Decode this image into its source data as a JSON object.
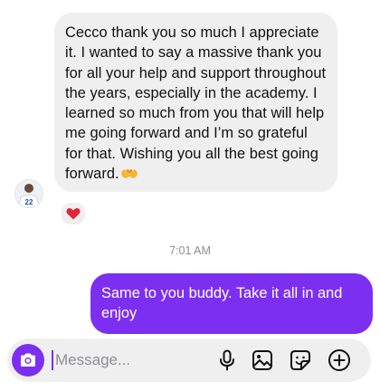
{
  "conversation": {
    "incoming_message": {
      "text": "Cecco thank you so much I appreciate it. I wanted to say a massive thank you for all your help and support throughout the years, especially in the academy. I learned so much from you that will help me going forward and I’m so grateful for that. Wishing you all the best going forward.",
      "trailing_emoji": "hands-heart-emoji",
      "reaction": "red-heart",
      "avatar_jersey_number": "22"
    },
    "timestamp": "7:01 AM",
    "outgoing_message": {
      "text": "Same to you buddy. Take it all in and enjoy"
    }
  },
  "composer": {
    "placeholder": "Message...",
    "icons": [
      "camera-icon",
      "microphone-icon",
      "gallery-icon",
      "sticker-icon",
      "plus-icon"
    ]
  },
  "colors": {
    "accent": "#7c2ff1",
    "incoming_bubble": "#efefef",
    "heart": "#e0263b",
    "emoji": "#f5b82e"
  }
}
